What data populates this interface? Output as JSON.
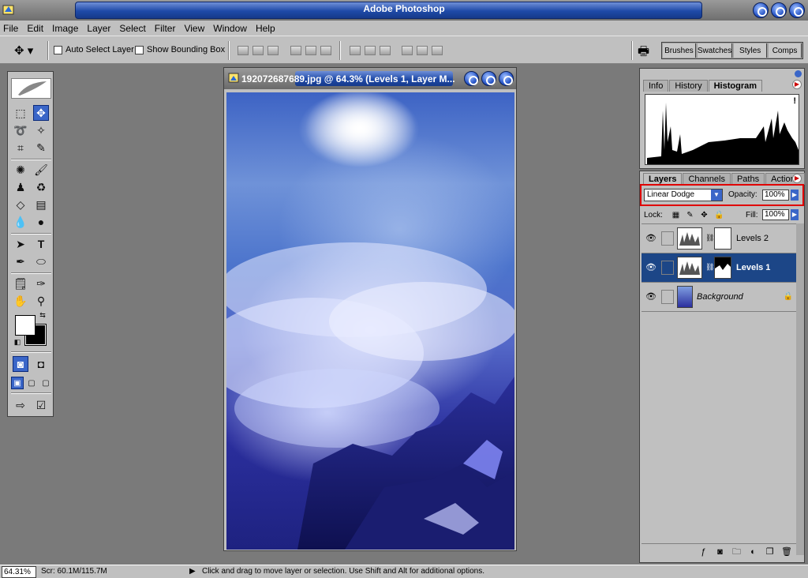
{
  "app": {
    "title": "Adobe Photoshop"
  },
  "menu": [
    "File",
    "Edit",
    "Image",
    "Layer",
    "Select",
    "Filter",
    "View",
    "Window",
    "Help"
  ],
  "options": {
    "auto_select_label": "Auto Select Layer",
    "bounding_box_label": "Show Bounding Box",
    "palette_well": [
      "Brushes",
      "Swatches",
      "Styles",
      "Comps"
    ]
  },
  "document": {
    "title": "192072687689.jpg @ 64.3% (Levels 1, Layer M..."
  },
  "info_palette": {
    "tabs": [
      "Info",
      "History",
      "Histogram"
    ],
    "active_tab": "Histogram",
    "warning": "!"
  },
  "layers_palette": {
    "tabs": [
      "Layers",
      "Channels",
      "Paths",
      "Actions"
    ],
    "active_tab": "Layers",
    "blend_mode": "Linear Dodge",
    "opacity_label": "Opacity:",
    "opacity": "100%",
    "lock_label": "Lock:",
    "fill_label": "Fill:",
    "fill": "100%",
    "layers": [
      {
        "name": "Levels 2",
        "selected": false
      },
      {
        "name": "Levels 1",
        "selected": true
      },
      {
        "name": "Background",
        "selected": false
      }
    ]
  },
  "status": {
    "zoom": "64.31%",
    "scratch": "Scr: 60.1M/115.7M",
    "hint": "Click and drag to move layer or selection.  Use Shift and Alt for additional options."
  }
}
